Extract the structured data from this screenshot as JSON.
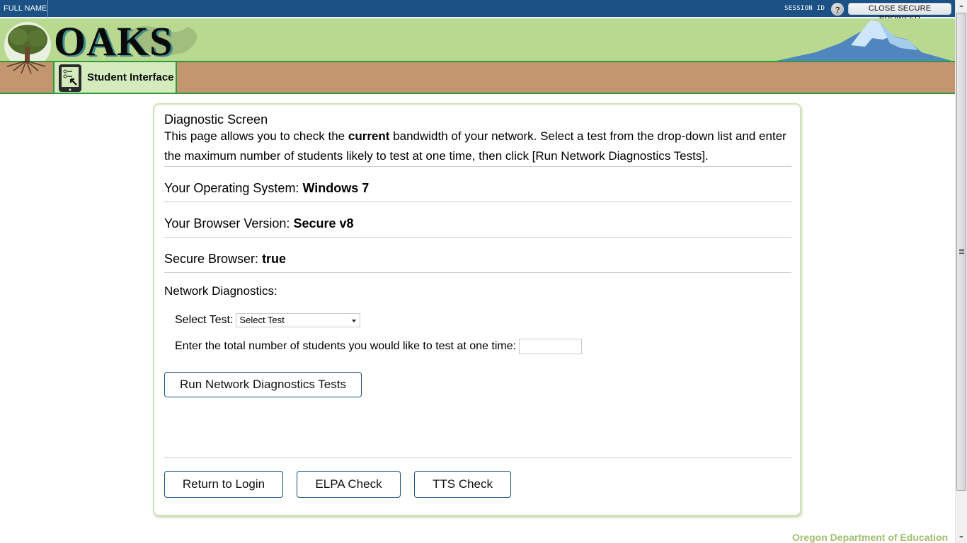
{
  "topbar": {
    "full_name": "FULL NAME",
    "session_id": "SESSION ID",
    "help_label": "?",
    "close_button": "CLOSE SECURE BROWSER"
  },
  "banner": {
    "logo_text": "OAKS",
    "tab_label": "Student Interface"
  },
  "main": {
    "title": "Diagnostic Screen",
    "intro_before": "This page allows you to check the ",
    "intro_bold": "current",
    "intro_after": " bandwidth of your network. Select a test from the drop-down list and enter the maximum number of students likely to test at one time, then click [Run Network Diagnostics Tests].",
    "info": [
      {
        "label": "Your Operating System: ",
        "value": "Windows 7"
      },
      {
        "label": "Your Browser Version: ",
        "value": "Secure v8"
      },
      {
        "label": "Secure Browser: ",
        "value": "true"
      }
    ],
    "network_label": "Network Diagnostics:",
    "select_label": "Select Test:",
    "select_value": "Select Test",
    "students_label": "Enter the total number of students you would like to test at one time:",
    "students_value": "",
    "run_button": "Run Network Diagnostics Tests",
    "footer_buttons": [
      "Return to Login",
      "ELPA Check",
      "TTS Check"
    ]
  },
  "footer": {
    "org": "Oregon Department of Education"
  },
  "colors": {
    "topbar": "#1b5185",
    "banner_green": "#b8d98f",
    "brown_bar": "#c39670",
    "accent_green": "#2e9a3a",
    "footer_text": "#9ec06f",
    "button_border": "#1b4f7c"
  }
}
